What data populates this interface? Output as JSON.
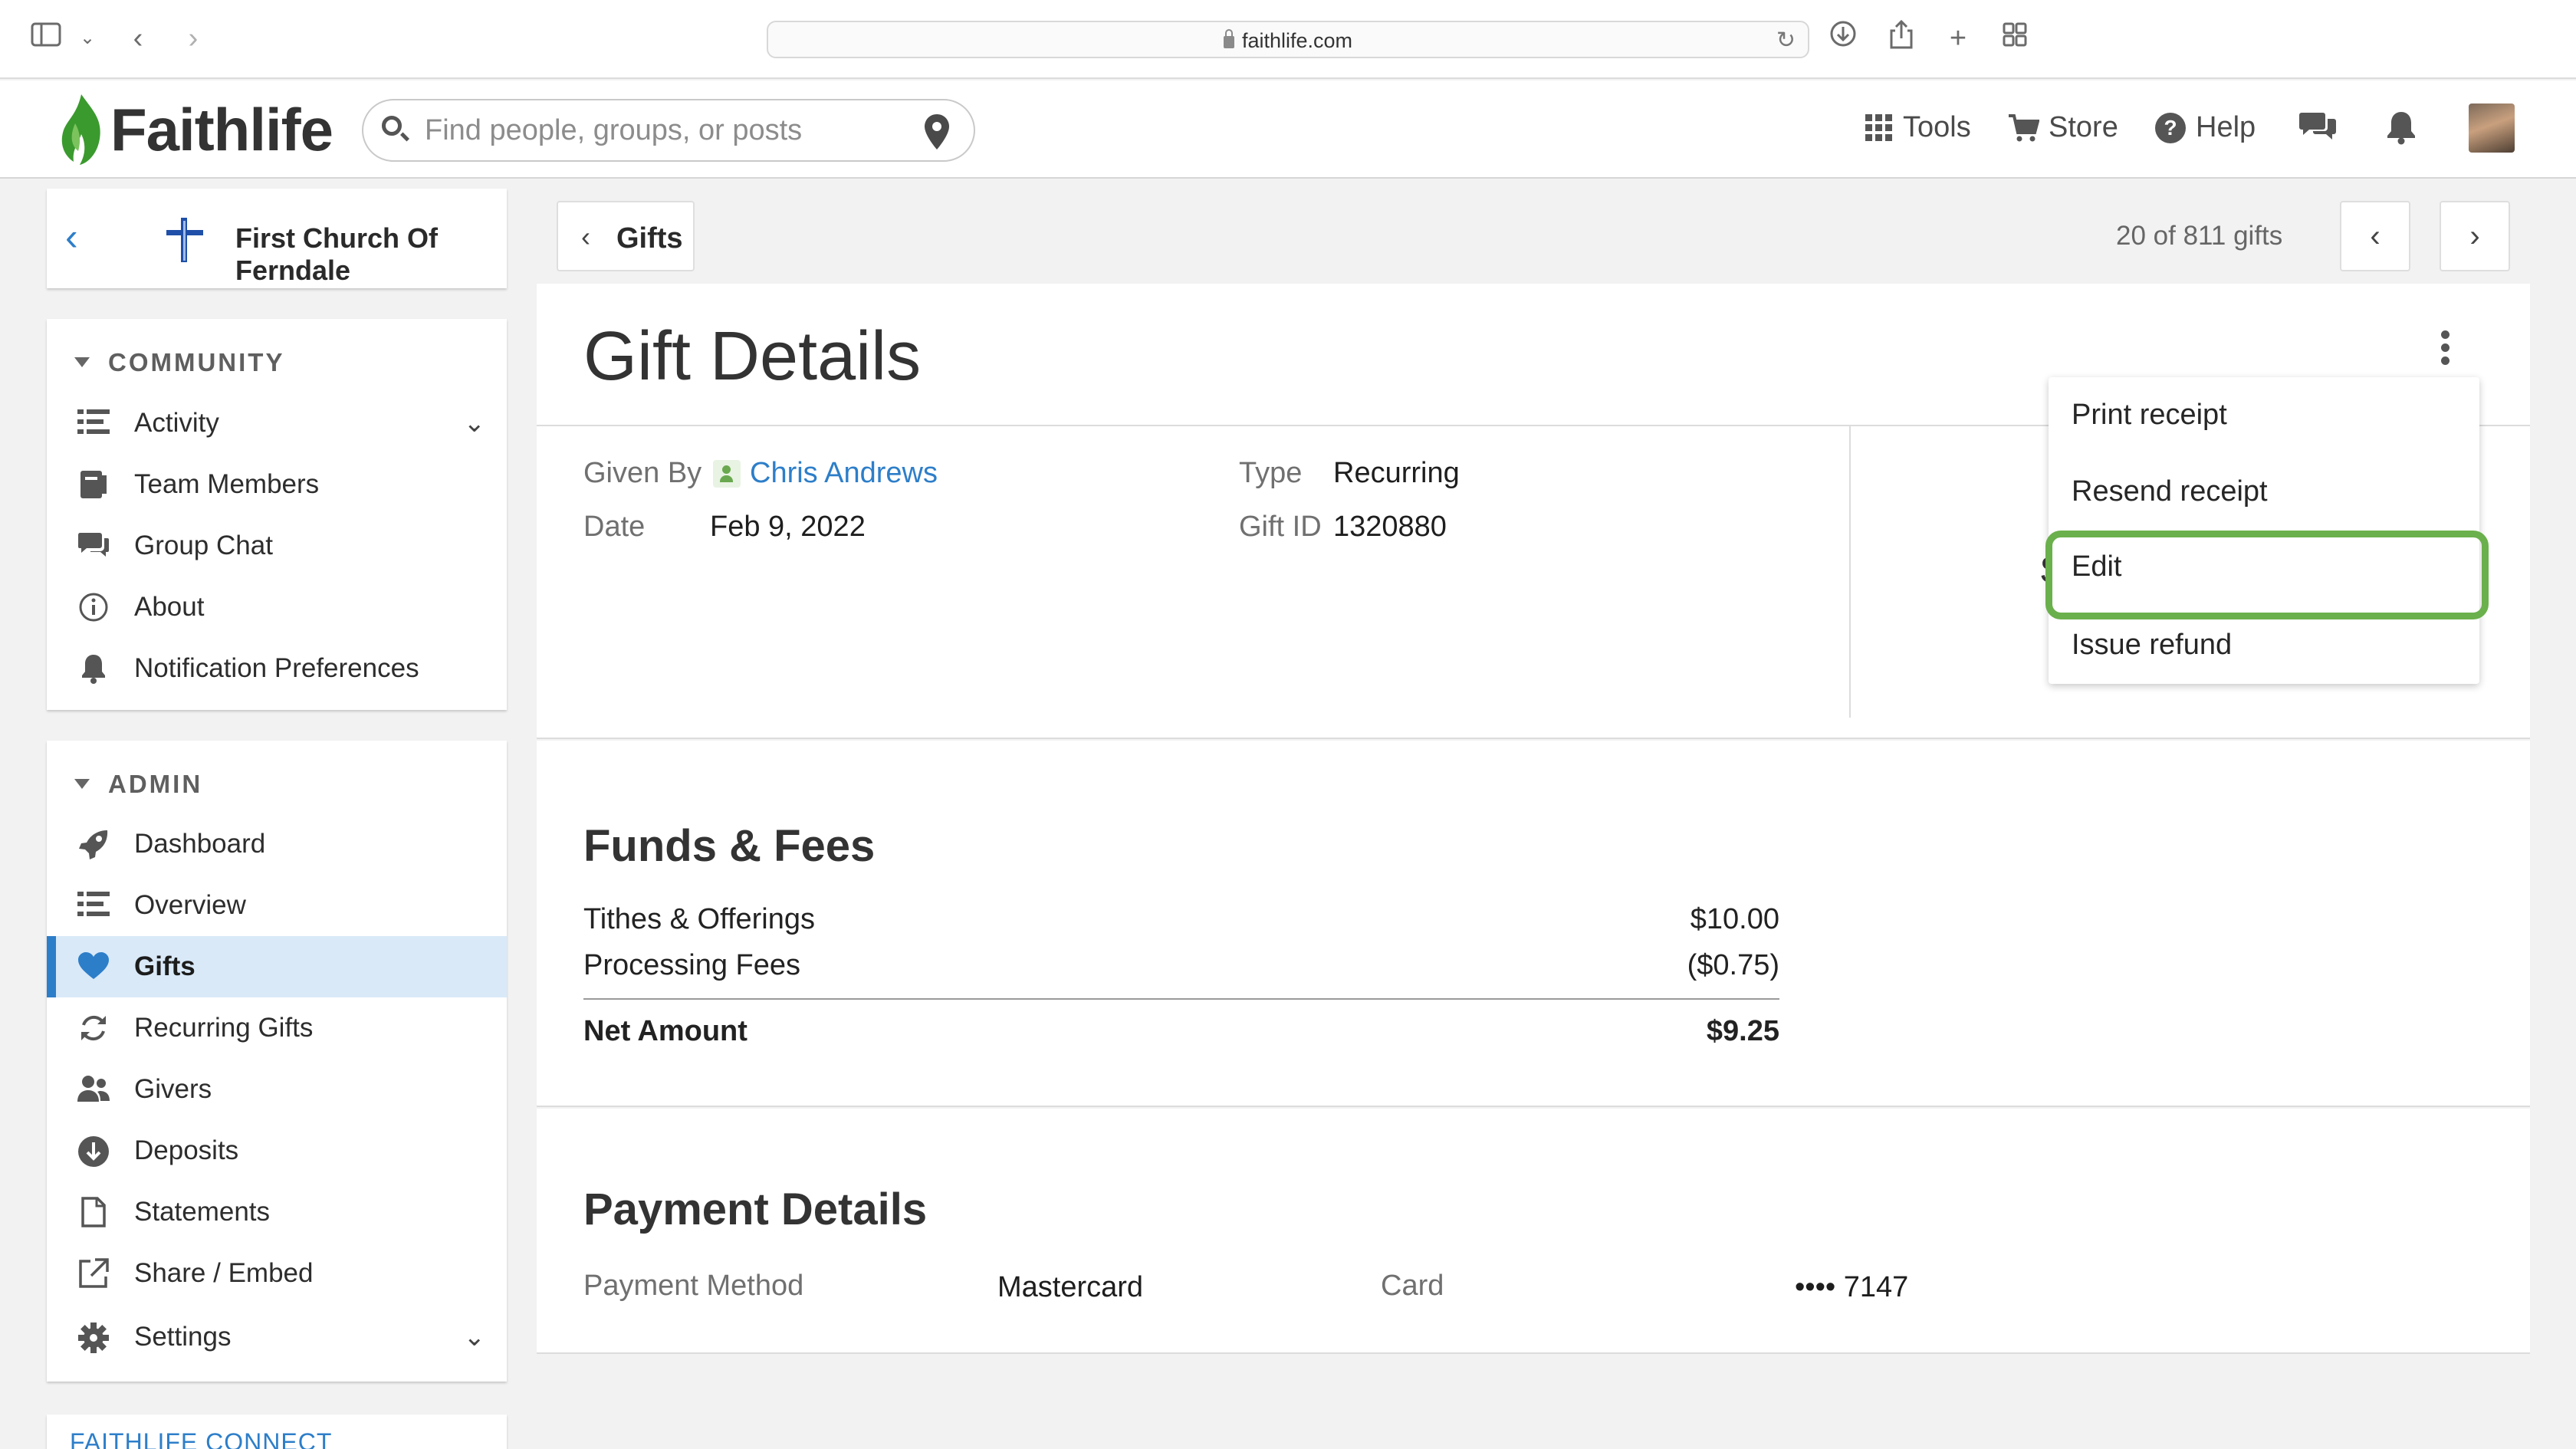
{
  "browser": {
    "url": "faithlife.com"
  },
  "header": {
    "logo_text": "Faithlife",
    "search_placeholder": "Find people, groups, or posts",
    "tools_label": "Tools",
    "store_label": "Store",
    "help_label": "Help"
  },
  "sidebar": {
    "church_name": "First Church Of Ferndale",
    "community": {
      "heading": "COMMUNITY",
      "items": [
        {
          "label": "Activity",
          "icon": "activity-list-icon",
          "expandable": true
        },
        {
          "label": "Team Members",
          "icon": "team-members-icon"
        },
        {
          "label": "Group Chat",
          "icon": "chat-bubble-icon"
        },
        {
          "label": "About",
          "icon": "info-icon"
        },
        {
          "label": "Notification Preferences",
          "icon": "bell-icon"
        }
      ]
    },
    "admin": {
      "heading": "ADMIN",
      "items": [
        {
          "label": "Dashboard",
          "icon": "rocket-icon"
        },
        {
          "label": "Overview",
          "icon": "overview-list-icon"
        },
        {
          "label": "Gifts",
          "icon": "heart-icon",
          "active": true
        },
        {
          "label": "Recurring Gifts",
          "icon": "recurring-icon"
        },
        {
          "label": "Givers",
          "icon": "givers-icon"
        },
        {
          "label": "Deposits",
          "icon": "deposit-icon"
        },
        {
          "label": "Statements",
          "icon": "document-icon"
        },
        {
          "label": "Share / Embed",
          "icon": "share-external-icon"
        },
        {
          "label": "Settings",
          "icon": "gear-icon",
          "expandable": true
        }
      ]
    },
    "footer_heading": "FAITHLIFE CONNECT"
  },
  "topbar": {
    "back_label": "Gifts",
    "counter": "20 of 811 gifts"
  },
  "gift": {
    "title": "Gift Details",
    "given_by_label": "Given By",
    "given_by_value": "Chris Andrews",
    "date_label": "Date",
    "date_value": "Feb 9, 2022",
    "type_label": "Type",
    "type_value": "Recurring",
    "gift_id_label": "Gift ID",
    "gift_id_value": "1320880"
  },
  "funds": {
    "heading": "Funds & Fees",
    "rows": [
      {
        "label": "Tithes & Offerings",
        "amount": "$10.00"
      },
      {
        "label": "Processing Fees",
        "amount": "($0.75)"
      }
    ],
    "total": {
      "label": "Net Amount",
      "amount": "$9.25"
    }
  },
  "payment": {
    "heading": "Payment Details",
    "method_label": "Payment Method",
    "method_value": "Mastercard",
    "card_label": "Card",
    "card_value": "•••• 7147"
  },
  "actions_menu": {
    "items": [
      "Print receipt",
      "Resend receipt",
      "Edit",
      "Issue refund"
    ],
    "highlighted": "Edit",
    "highlight_color": "#6ab04c"
  },
  "colors": {
    "accent": "#2d7ec9",
    "active_bg": "#d9e9f8",
    "logo_green": "#3a9a2e"
  }
}
